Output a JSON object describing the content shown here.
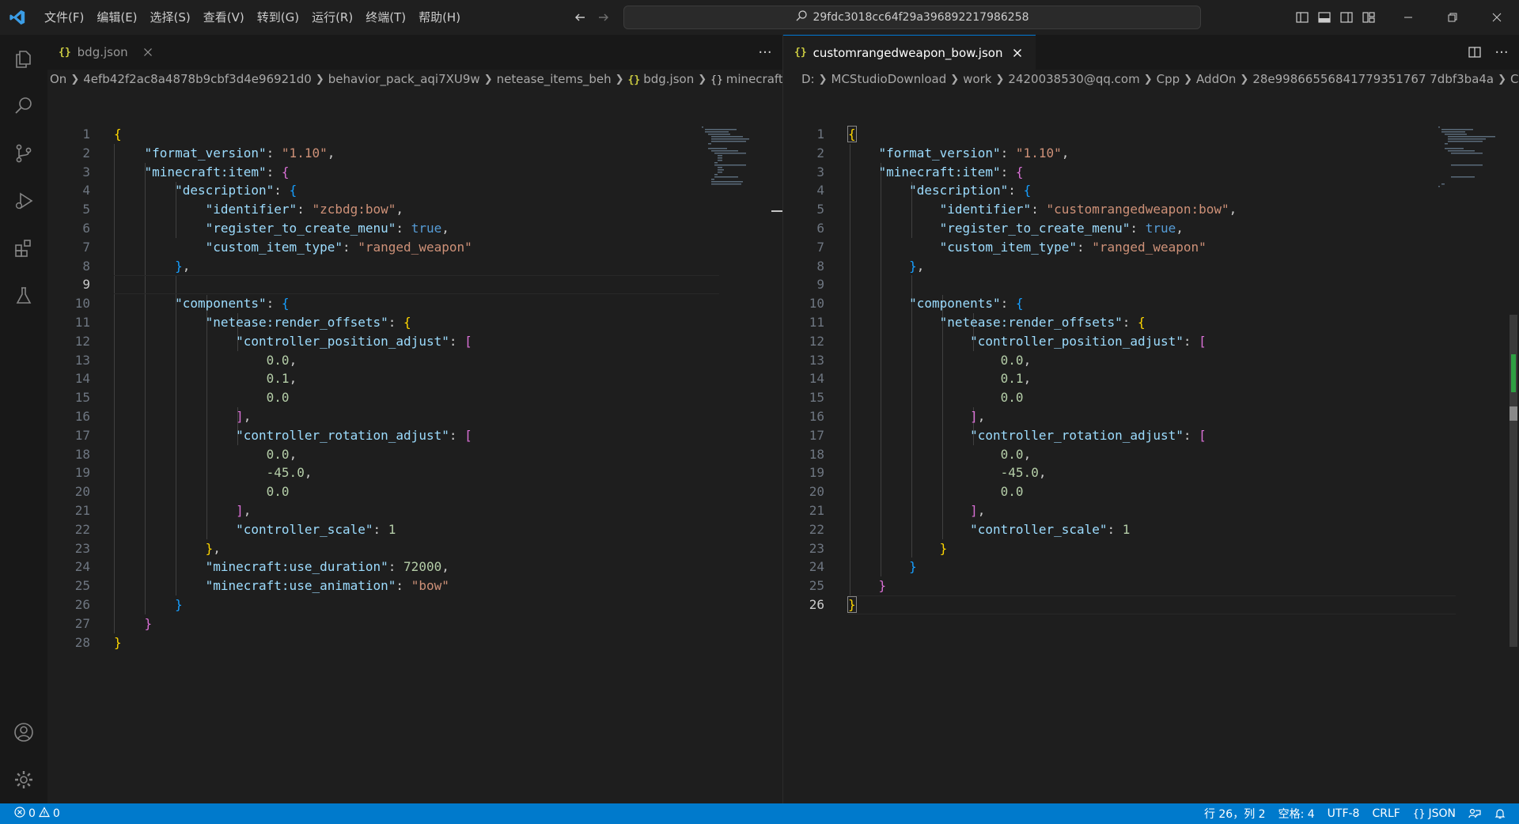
{
  "titlebar": {
    "menu": [
      "文件(F)",
      "编辑(E)",
      "选择(S)",
      "查看(V)",
      "转到(G)",
      "运行(R)",
      "终端(T)",
      "帮助(H)"
    ],
    "search_text": "29fdc3018cc64f29a396892217986258"
  },
  "left_editor": {
    "tab": {
      "label": "bdg.json",
      "icon": "json-braces-icon"
    },
    "breadcrumb": [
      "On",
      "4efb42f2ac8a4878b9cbf3d4e96921d0",
      "behavior_pack_aqi7XU9w",
      "netease_items_beh",
      "bdg.json",
      "minecraft:item"
    ],
    "line_numbers": [
      "1",
      "2",
      "3",
      "4",
      "5",
      "6",
      "7",
      "8",
      "9",
      "10",
      "11",
      "12",
      "13",
      "14",
      "15",
      "16",
      "17",
      "18",
      "19",
      "20",
      "21",
      "22",
      "23",
      "24",
      "25",
      "26",
      "27",
      "28"
    ],
    "current_line": 9
  },
  "right_editor": {
    "tab": {
      "label": "customrangedweapon_bow.json",
      "icon": "json-braces-icon"
    },
    "breadcrumb": [
      "D:",
      "MCStudioDownload",
      "work",
      "2420038530@qq.com",
      "Cpp",
      "AddOn",
      "28e99866556841779351767 7dbf3ba4a",
      "CustomR"
    ],
    "line_numbers": [
      "1",
      "2",
      "3",
      "4",
      "5",
      "6",
      "7",
      "8",
      "9",
      "10",
      "11",
      "12",
      "13",
      "14",
      "15",
      "16",
      "17",
      "18",
      "19",
      "20",
      "21",
      "22",
      "23",
      "24",
      "25",
      "26"
    ],
    "current_line": 26
  },
  "code_tokens": {
    "format_version_key": "\"format_version\"",
    "format_version_val": "\"1.10\"",
    "item_key": "\"minecraft:item\"",
    "description_key": "\"description\"",
    "identifier_key": "\"identifier\"",
    "identifier_left": "\"zcbdg:bow\"",
    "identifier_right": "\"customrangedweapon:bow\"",
    "register_key": "\"register_to_create_menu\"",
    "true_val": "true",
    "custom_type_key": "\"custom_item_type\"",
    "custom_type_val": "\"ranged_weapon\"",
    "components_key": "\"components\"",
    "render_offsets_key": "\"netease:render_offsets\"",
    "position_key": "\"controller_position_adjust\"",
    "rotation_key": "\"controller_rotation_adjust\"",
    "scale_key": "\"controller_scale\"",
    "scale_val": "1",
    "n00": "0.0",
    "n01": "0.1",
    "nm45": "-45.0",
    "use_duration_key": "\"minecraft:use_duration\"",
    "use_duration_val": "72000",
    "use_animation_key": "\"minecraft:use_animation\"",
    "use_animation_val": "\"bow\""
  },
  "statusbar": {
    "errors": "0",
    "warnings": "0",
    "position": "行 26，列 2",
    "spaces": "空格: 4",
    "encoding": "UTF-8",
    "eol": "CRLF",
    "language": "JSON"
  },
  "colors": {
    "accent": "#007acc",
    "key": "#9cdcfe",
    "string": "#ce9178",
    "number": "#b5cea8",
    "bracket1": "#ffd700",
    "bracket2": "#da70d6",
    "bracket3": "#179fff"
  }
}
